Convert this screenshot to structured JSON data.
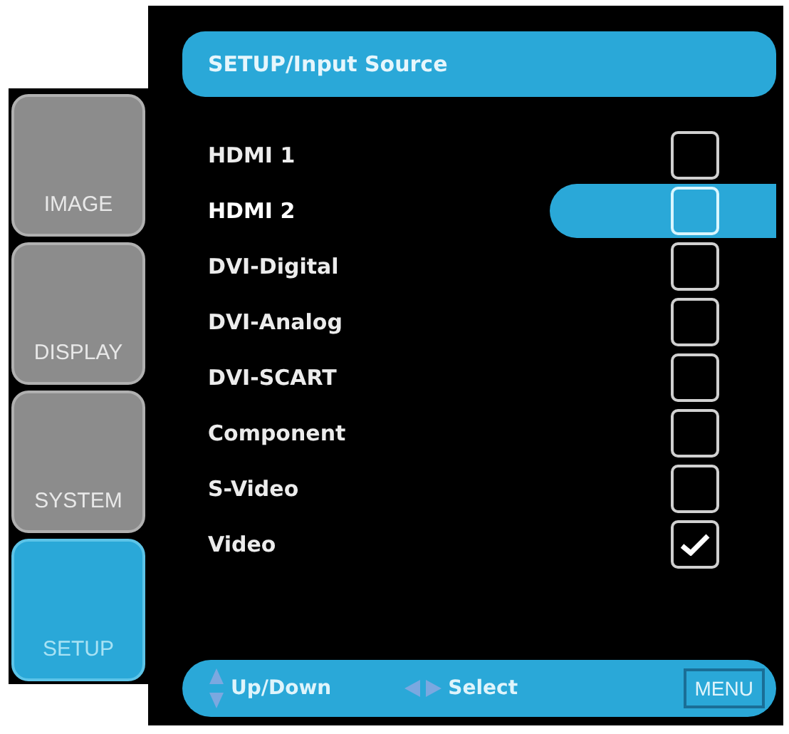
{
  "tabs": [
    {
      "label": "IMAGE",
      "selected": false
    },
    {
      "label": "DISPLAY",
      "selected": false
    },
    {
      "label": "SYSTEM",
      "selected": false
    },
    {
      "label": "SETUP",
      "selected": true
    }
  ],
  "header": {
    "title": "SETUP/Input Source"
  },
  "sources": [
    {
      "label": "HDMI 1",
      "selected": false,
      "checked": false
    },
    {
      "label": "HDMI 2",
      "selected": true,
      "checked": false
    },
    {
      "label": "DVI-Digital",
      "selected": false,
      "checked": false
    },
    {
      "label": "DVI-Analog",
      "selected": false,
      "checked": false
    },
    {
      "label": "DVI-SCART",
      "selected": false,
      "checked": false
    },
    {
      "label": "Component",
      "selected": false,
      "checked": false
    },
    {
      "label": "S-Video",
      "selected": false,
      "checked": false
    },
    {
      "label": "Video",
      "selected": false,
      "checked": true
    }
  ],
  "footer": {
    "hints": [
      {
        "kind": "updown",
        "label": "Up/Down"
      },
      {
        "kind": "leftright",
        "label": "Select"
      }
    ],
    "menu_key": "MENU"
  }
}
